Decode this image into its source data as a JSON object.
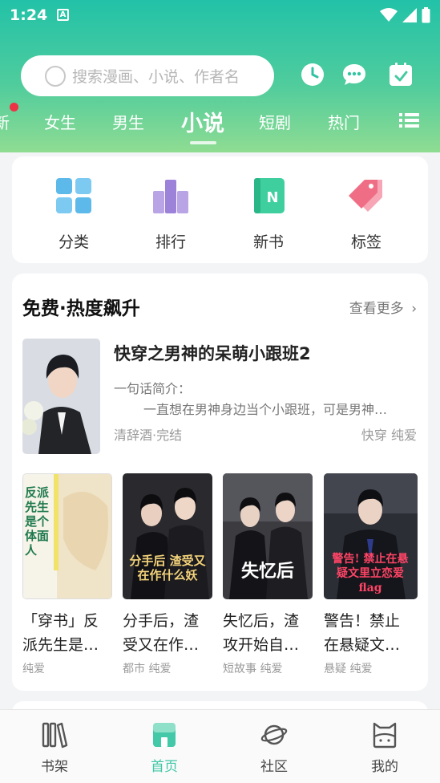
{
  "status": {
    "time": "1:24",
    "notif_letter": "A"
  },
  "search": {
    "placeholder": "搜索漫画、小说、作者名"
  },
  "category_tabs": {
    "partial": "新",
    "items": [
      "女生",
      "男生",
      "小说",
      "短剧",
      "热门"
    ],
    "active": "小说"
  },
  "quick_links": [
    {
      "label": "分类",
      "icon": "grid-icon"
    },
    {
      "label": "排行",
      "icon": "ranking-icon"
    },
    {
      "label": "新书",
      "icon": "new-book-icon"
    },
    {
      "label": "标签",
      "icon": "tag-icon"
    }
  ],
  "free_section": {
    "title": "免费·热度飙升",
    "see_more": "查看更多",
    "featured": {
      "title": "快穿之男神的呆萌小跟班2",
      "intro_label": "一句话简介：",
      "intro": "一直想在男神身边当个小跟班，可是男神…",
      "meta": "清辞酒·完结",
      "tags": "快穿 纯爱"
    },
    "books": [
      {
        "title": "「穿书」反派先生是…",
        "tags": "纯爱",
        "cover_text": "反派先生 是个体面人"
      },
      {
        "title": "分手后，渣受又在作…",
        "tags": "都市 纯爱",
        "cover_text": "分手后 渣受又在作什么妖"
      },
      {
        "title": "失忆后，渣攻开始自…",
        "tags": "短故事 纯爱",
        "cover_text": "失忆后"
      },
      {
        "title": "警告！禁止在悬疑文…",
        "tags": "悬疑 纯爱",
        "cover_text": "警告! 禁止在悬疑文里立恋爱flag"
      }
    ]
  },
  "bottom_nav": [
    {
      "label": "书架",
      "active": false
    },
    {
      "label": "首页",
      "active": true
    },
    {
      "label": "社区",
      "active": false
    },
    {
      "label": "我的",
      "active": false
    }
  ],
  "colors": {
    "accent": "#3fc7a6",
    "header_top": "#22c2a8",
    "header_bottom": "#8fdc92",
    "red_dot": "#ee3344"
  }
}
